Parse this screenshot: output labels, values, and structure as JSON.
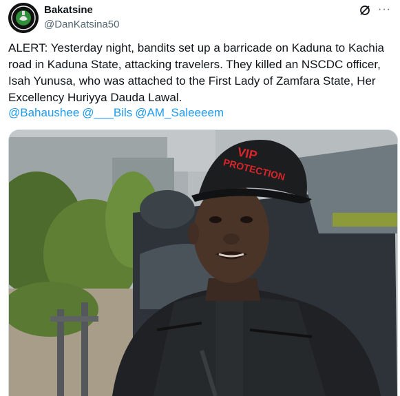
{
  "author": {
    "display_name": "Bakatsine",
    "handle": "@DanKatsina50",
    "avatar_icon": "bakatsine-logo"
  },
  "tweet": {
    "text": "ALERT: Yesterday night, bandits set up a barricade on Kaduna to Kachia road in Kaduna State, attacking travelers. They killed an NSCDC officer, Isah Yunusa, who was attached to the First Lady of Zamfara State, Her Excellency Huriyya Dauda Lawal.",
    "mentions": [
      "@Bahaushee",
      "@___Bils",
      "@AM_Saleeeem"
    ]
  },
  "media": {
    "cap_text_line1": "VIP",
    "cap_text_line2": "PROTECTION"
  },
  "icons": {
    "grok": "grok-icon",
    "more": "more-icon"
  },
  "colors": {
    "link": "#1d9bf0",
    "secondary_text": "#536471",
    "cap_text": "#d8262b"
  }
}
